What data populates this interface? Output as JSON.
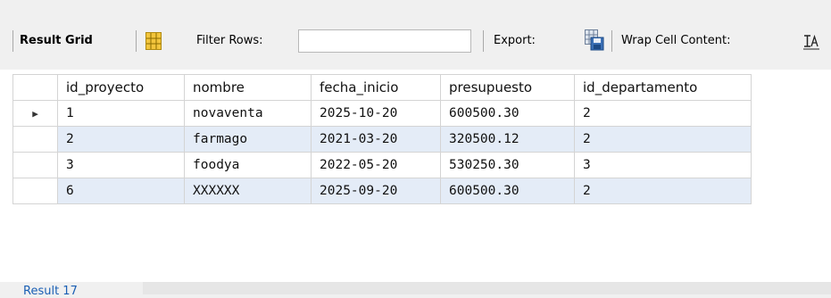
{
  "toolbar": {
    "result_grid_label": "Result Grid",
    "filter_label": "Filter Rows:",
    "filter_value": "",
    "export_label": "Export:",
    "wrap_label": "Wrap Cell Content:"
  },
  "grid": {
    "columns": [
      "id_proyecto",
      "nombre",
      "fecha_inicio",
      "presupuesto",
      "id_departamento"
    ],
    "rows": [
      {
        "indicator": "▶",
        "cells": [
          "1",
          "novaventa",
          "2025-10-20",
          "600500.30",
          "2"
        ]
      },
      {
        "indicator": "",
        "cells": [
          "2",
          "farmago",
          "2021-03-20",
          "320500.12",
          "2"
        ]
      },
      {
        "indicator": "",
        "cells": [
          "3",
          "foodya",
          "2022-05-20",
          "530250.30",
          "3"
        ]
      },
      {
        "indicator": "",
        "cells": [
          "6",
          "XXXXXX",
          "2025-09-20",
          "600500.30",
          "2"
        ]
      }
    ]
  },
  "bottom": {
    "tab_label": "Result 17"
  },
  "icons": {
    "result_grid_icon": "grid-layout-icon",
    "export_icon": "export-table-icon",
    "wrap_icon": "wrap-text-icon"
  },
  "colors": {
    "alt_row": "#e4ecf7",
    "grid_icon_yellow": "#f2c53d"
  }
}
